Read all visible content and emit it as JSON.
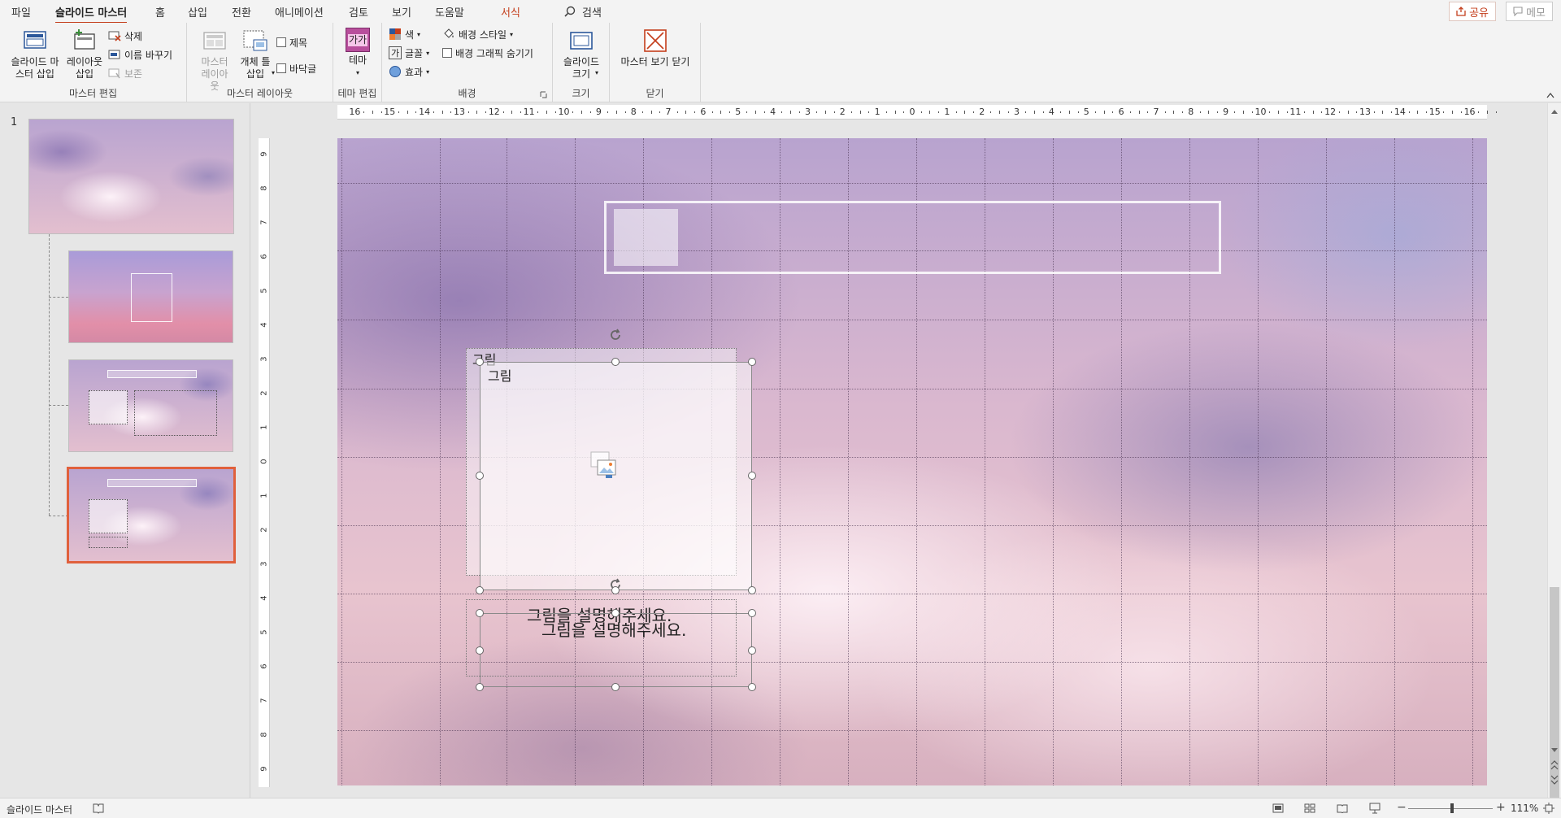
{
  "tabs": [
    {
      "label": "파일"
    },
    {
      "label": "슬라이드 마스터"
    },
    {
      "label": "홈"
    },
    {
      "label": "삽입"
    },
    {
      "label": "전환"
    },
    {
      "label": "애니메이션"
    },
    {
      "label": "검토"
    },
    {
      "label": "보기"
    },
    {
      "label": "도움말"
    },
    {
      "label": "서식"
    }
  ],
  "search": {
    "label": "검색"
  },
  "share": {
    "label": "공유"
  },
  "memo": {
    "label": "메모"
  },
  "ribbon": {
    "master_edit": {
      "label": "마스터 편집",
      "insert_master": "슬라이드 마\n스터 삽입",
      "insert_layout": "레이아웃\n삽입",
      "delete": "삭제",
      "rename": "이름 바꾸기",
      "preserve": "보존"
    },
    "master_layout": {
      "label": "마스터 레이아웃",
      "master_layout_btn": "마스터\n레이아웃",
      "insert_placeholder": "개체 틀\n삽입",
      "title_check": "제목",
      "footer_check": "바닥글"
    },
    "theme_edit": {
      "label": "테마 편집",
      "theme": "테마",
      "theme_glyph": "가가"
    },
    "background": {
      "label": "배경",
      "colors": "색",
      "fonts": "글꼴",
      "effects": "효과",
      "bg_styles": "배경 스타일",
      "hide_bg": "배경 그래픽 숨기기",
      "font_glyph": "가"
    },
    "size": {
      "label": "크기",
      "slide_size": "슬라이드\n크기"
    },
    "close": {
      "label": "닫기",
      "close_master": "마스터 보기 닫기"
    }
  },
  "thumbnails": {
    "first_number": "1"
  },
  "slide": {
    "placeholder_label_back": "그림",
    "placeholder_label_front": "그림",
    "caption_back": "그림을 설명해주세요.",
    "caption_front": "그림을 설명해주세요."
  },
  "ruler": {
    "h_labels": [
      "16",
      "15",
      "14",
      "13",
      "12",
      "11",
      "10",
      "9",
      "8",
      "7",
      "6",
      "5",
      "4",
      "3",
      "2",
      "1",
      "0",
      "1",
      "2",
      "3",
      "4",
      "5",
      "6",
      "7",
      "8",
      "9",
      "10",
      "11",
      "12",
      "13",
      "14",
      "15",
      "16"
    ],
    "v_labels": [
      "9",
      "8",
      "7",
      "6",
      "5",
      "4",
      "3",
      "2",
      "1",
      "0",
      "1",
      "2",
      "3",
      "4",
      "5",
      "6",
      "7",
      "8",
      "9"
    ]
  },
  "status": {
    "mode": "슬라이드 마스터",
    "zoom": "111%"
  },
  "colors": {
    "accent": "#c43e1c",
    "selection": "#e0603c"
  }
}
